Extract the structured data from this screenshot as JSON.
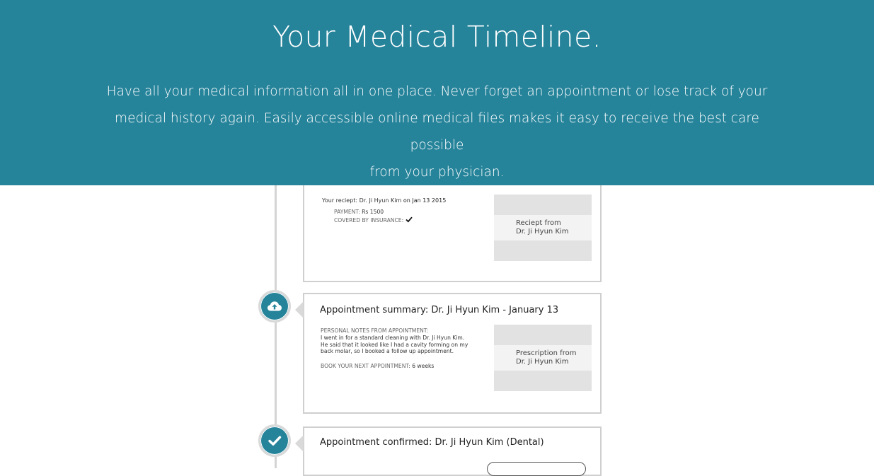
{
  "hero": {
    "title": "Your Medical Timeline.",
    "description_line1": "Have all your medical information all in one place. Never forget an appointment or lose track of your",
    "description_line2": "medical history again. Easily accessible online medical files makes it easy to receive the best care possible",
    "description_line3": "from your physician."
  },
  "colors": {
    "accent": "#25839a",
    "timeline_line": "#d4d4d4",
    "card_border": "#cfcfcf"
  },
  "timeline": {
    "receipt": {
      "title_prefix": "Your reciept: Dr. Ji Hyun Kim",
      "title_suffix": "on Jan 13 2015",
      "payment_label": "PAYMENT:",
      "payment_value": "Rs 1500",
      "insurance_label": "COVERED BY INSURANCE:",
      "insurance_icon": "checkmark-icon",
      "thumb_line1": "Reciept from",
      "thumb_line2": "Dr. Ji Hyun Kim"
    },
    "summary": {
      "icon": "cloud-upload-icon",
      "title": "Appointment summary: Dr. Ji Hyun Kim - January 13",
      "notes_label": "PERSONAL NOTES FROM APPOINTMENT:",
      "notes_line1": "I went in for a standard cleaning with Dr. Ji Hyun Kim.",
      "notes_line2": "He said that it looked like I had a cavity forming on my",
      "notes_line3": "back molar, so I booked a follow up appointment.",
      "next_label": "BOOK YOUR NEXT APPOINTMENT:",
      "next_value": "6 weeks",
      "thumb_line1": "Prescription from",
      "thumb_line2": "Dr. Ji Hyun Kim"
    },
    "confirmed": {
      "icon": "checkmark-circle-icon",
      "title": "Appointment confirmed: Dr. Ji Hyun Kim (Dental)"
    }
  }
}
